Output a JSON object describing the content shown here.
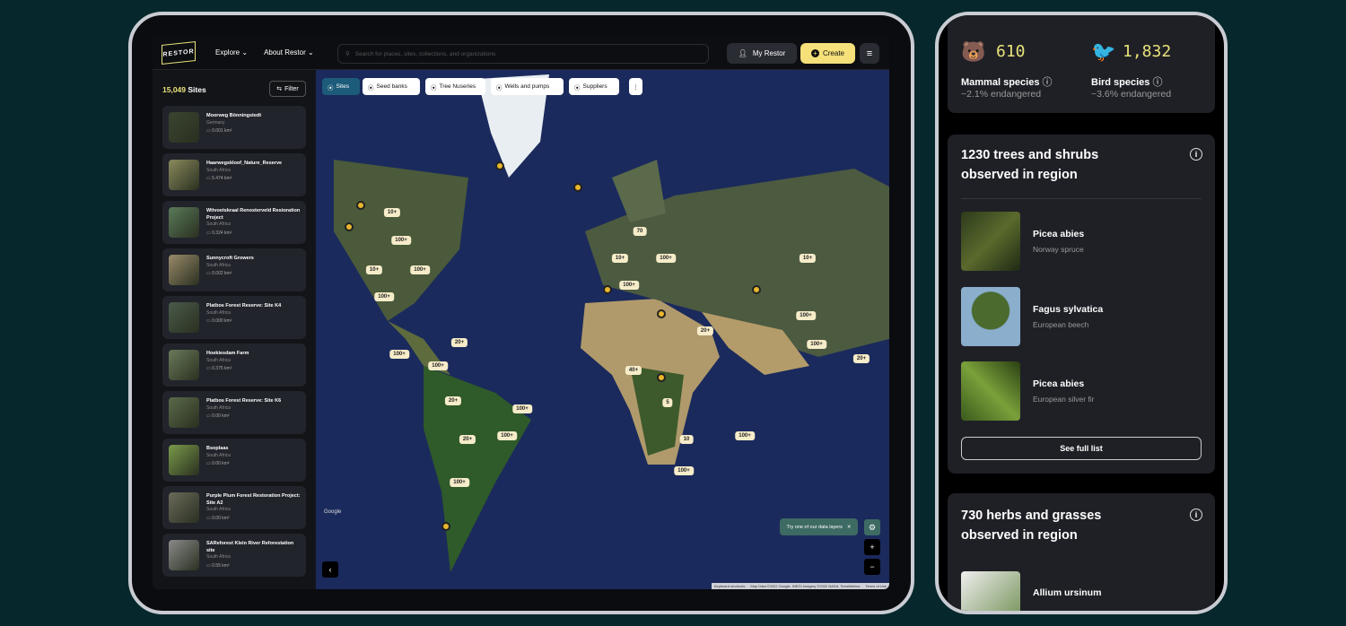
{
  "header": {
    "logo": "RESTOR",
    "nav": [
      "Explore",
      "About Restor"
    ],
    "search_placeholder": "Search for places, sites, collections, and organizations",
    "my_restor": "My Restor",
    "create": "Create"
  },
  "sidebar": {
    "count": "15,049",
    "count_suffix": " Sites",
    "filter": "Filter",
    "sites": [
      {
        "name": "Moorweg Bönningstedt",
        "country": "Germany",
        "area": "0.001 km²"
      },
      {
        "name": "Haarwegskloof_Nature_Reserve",
        "country": "South Africa",
        "area": "5.474 km²"
      },
      {
        "name": "Witvoetskraal Renosterveld Restoration Project",
        "country": "South Africa",
        "area": "0.324 km²"
      },
      {
        "name": "Sunnycroft Growers",
        "country": "South Africa",
        "area": "0.002 km²"
      },
      {
        "name": "Platbos Forest Reserve: Site K4",
        "country": "South Africa",
        "area": "0.000 km²"
      },
      {
        "name": "Hoekiesdam Farm",
        "country": "South Africa",
        "area": "0.375 km²"
      },
      {
        "name": "Platbos Forest Reserve: Site K6",
        "country": "South Africa",
        "area": "0.00 km²"
      },
      {
        "name": "Bsoplaas",
        "country": "South Africa",
        "area": "0.00 km²"
      },
      {
        "name": "Purple Plum Forest Restoration Project: Site A2",
        "country": "South Africa",
        "area": "0.00 km²"
      },
      {
        "name": "SAReforest Klein River Reforestation site",
        "country": "South Africa",
        "area": "0.55 km²"
      }
    ]
  },
  "map": {
    "filters": [
      "Sites",
      "Seed banks",
      "Tree Nuseries",
      "Wells and pumps",
      "Suppliers"
    ],
    "clusters": [
      "10+",
      "100+",
      "10+",
      "100+",
      "100+",
      "70",
      "10+",
      "100+",
      "100+",
      "10+",
      "100+",
      "100+",
      "20+",
      "20+",
      "100+",
      "100+",
      "20+",
      "40+",
      "5",
      "20+",
      "100+",
      "20+",
      "100+",
      "10",
      "100+",
      "100+",
      "100+"
    ],
    "tooltip": "Try one of our data layers",
    "google": "Google",
    "attribution": [
      "Keyboard shortcuts",
      "Map Data ©2022 Google, INEGI Imagery ©2022 NASA, TerraMetrics",
      "Terms of Use"
    ]
  },
  "phone": {
    "mammals": {
      "count": "610",
      "label": "Mammal species",
      "sub": "~2.1%  endangered"
    },
    "birds": {
      "count": "1,832",
      "label": "Bird species",
      "sub": "~3.6%  endangered"
    },
    "trees": {
      "title": "1230 trees and shrubs observed in region",
      "items": [
        {
          "name": "Picea abies",
          "common": "Norway spruce"
        },
        {
          "name": "Fagus sylvatica",
          "common": "European beech"
        },
        {
          "name": "Picea abies",
          "common": "European silver fir"
        }
      ],
      "see_all": "See full list"
    },
    "herbs": {
      "title": "730 herbs and grasses observed in region",
      "items": [
        {
          "name": "Allium ursinum"
        }
      ]
    }
  }
}
